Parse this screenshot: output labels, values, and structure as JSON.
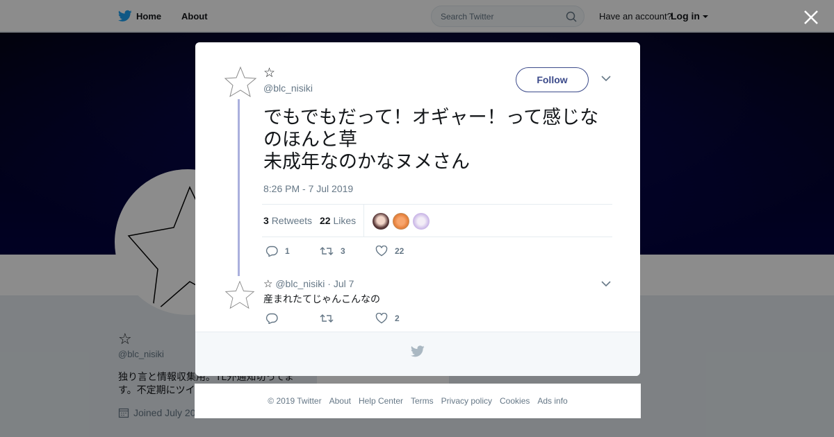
{
  "topbar": {
    "home_label": "Home",
    "about_label": "About",
    "search_placeholder": "Search Twitter",
    "have_account": "Have an account?",
    "login_label": "Log in"
  },
  "profile": {
    "name": "☆",
    "handle": "@blc_nisiki",
    "bio": "独り言と情報収集用。TL外通知切ってます。不定期にツイ",
    "joined": "Joined July 20"
  },
  "tweet": {
    "author_name": "☆",
    "author_handle": "@blc_nisiki",
    "follow_label": "Follow",
    "text": "でもでもだって！オギャー！って感じなのほんと草\n未成年なのかなヌメさん",
    "timestamp": "8:26 PM - 7 Jul 2019",
    "retweets_count": "3",
    "retweets_label": "Retweets",
    "likes_count": "22",
    "likes_label": "Likes",
    "reply_count": "1",
    "retweet_action_count": "3",
    "like_action_count": "22"
  },
  "reply": {
    "author_name": "☆",
    "author_handle": "@blc_nisiki",
    "separator": "·",
    "date": "Jul 7",
    "text": "産まれたてじゃんこんなの",
    "like_count": "2"
  },
  "footer": {
    "links": [
      "© 2019 Twitter",
      "About",
      "Help Center",
      "Terms",
      "Privacy policy",
      "Cookies",
      "Ads info"
    ]
  },
  "colors": {
    "twitter_blue": "#1da1f2",
    "follow_border": "#3b4a8a",
    "thread_line": "#aab0dd",
    "muted_text": "#657786"
  },
  "icons": [
    "twitter-bird-icon",
    "search-icon",
    "caret-down-icon",
    "close-icon",
    "star-avatar-icon",
    "reply-icon",
    "retweet-icon",
    "like-icon",
    "calendar-icon"
  ]
}
